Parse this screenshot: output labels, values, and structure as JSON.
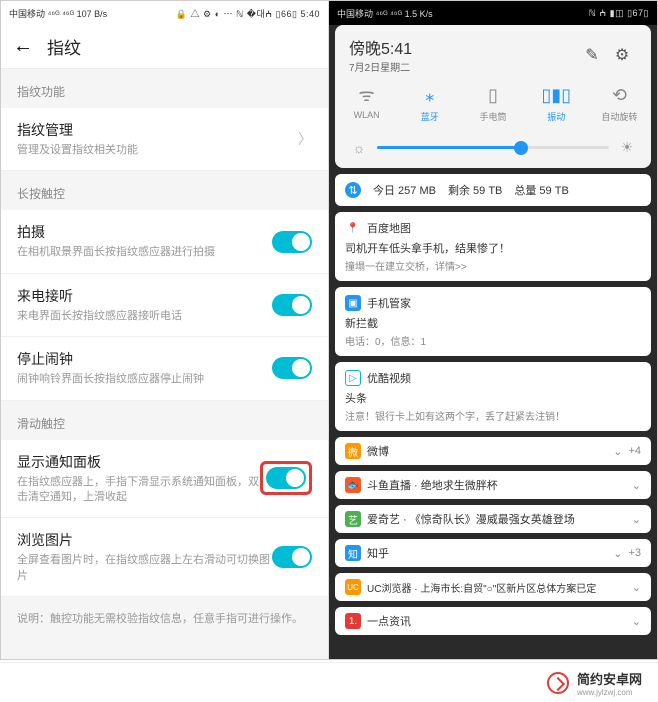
{
  "left": {
    "statusbar": {
      "carrier": "中国移动",
      "net": "⁴⁶ᴳ ⁴⁶ᴳ",
      "speed": "107 B/s",
      "icons": "🔒 △ ⚙ ◐ ⋯ ℕ �대ⵄ ▯66▯",
      "time": "5:40"
    },
    "title": "指纹",
    "sections": {
      "s1": "指纹功能",
      "s2": "长按触控",
      "s3": "滑动触控"
    },
    "rows": {
      "manage": {
        "t": "指纹管理",
        "s": "管理及设置指纹相关功能"
      },
      "shoot": {
        "t": "拍摄",
        "s": "在相机取景界面长按指纹感应器进行拍摄"
      },
      "call": {
        "t": "来电接听",
        "s": "来电界面长按指纹感应器接听电话"
      },
      "alarm": {
        "t": "停止闹钟",
        "s": "闹钟响铃界面长按指纹感应器停止闹钟"
      },
      "panel": {
        "t": "显示通知面板",
        "s": "在指纹感应器上，手指下滑显示系统通知面板，双击清空通知，上滑收起"
      },
      "photo": {
        "t": "浏览图片",
        "s": "全屏查看图片时，在指纹感应器上左右滑动可切换图片"
      }
    },
    "note": "说明：触控功能无需校验指纹信息，任意手指可进行操作。"
  },
  "right": {
    "statusbar": {
      "carrier": "中国移动",
      "speed": "1.5 K/s",
      "icons": "ℕ ⵄ ▮◫ ▯67▯"
    },
    "time": "傍晚5:41",
    "date": "7月2日星期二",
    "qs": [
      {
        "ic": "ᯤ",
        "lb": "WLAN",
        "on": false
      },
      {
        "ic": "⁎",
        "lb": "蓝牙",
        "on": true
      },
      {
        "ic": "▯",
        "lb": "手电筒",
        "on": false
      },
      {
        "ic": "▯▮▯",
        "lb": "振动",
        "on": true
      },
      {
        "ic": "⟲",
        "lb": "自动旋转",
        "on": false
      }
    ],
    "data": {
      "today": "今日 257 MB",
      "remain": "剩余 59 TB",
      "total": "总量 59 TB"
    },
    "cards": {
      "baidu": {
        "ic": "📍",
        "bg": "#e53935",
        "t": "百度地图",
        "l1": "司机开车低头拿手机，结果惨了！",
        "l2": "撞塌一在建立交桥，详情>>"
      },
      "guard": {
        "ic": "▣",
        "bg": "#2196f3",
        "t": "手机管家",
        "l1": "新拦截",
        "l2": "电话：0，信息：1"
      },
      "youku": {
        "ic": "▷",
        "bg": "#00bcd4",
        "t": "优酷视频",
        "l1": "头条",
        "l2": "注意！银行卡上如有这两个字，丢了赶紧去注销！"
      },
      "weibo": {
        "ic": "微",
        "bg": "#ff9800",
        "t": "微博",
        "badge": "+4"
      },
      "douyu": {
        "ic": "🐟",
        "bg": "#ff5722",
        "t": "斗鱼直播 · 绝地求生微胖杯"
      },
      "iqiyi": {
        "ic": "艺",
        "bg": "#4caf50",
        "t": "爱奇艺 · 《惊奇队长》漫威最强女英雄登场"
      },
      "zhihu": {
        "ic": "知",
        "bg": "#2196f3",
        "t": "知乎",
        "badge": "+3"
      },
      "uc": {
        "ic": "UC",
        "bg": "#ff9800",
        "t": "UC浏览器 · 上海市长:自贸\"○\"区新片区总体方案已定"
      },
      "yidian": {
        "ic": "1.",
        "bg": "#e53935",
        "t": "一点资讯"
      }
    }
  },
  "footer": {
    "brand": "简约安卓网",
    "url": "www.jylzwj.com"
  }
}
